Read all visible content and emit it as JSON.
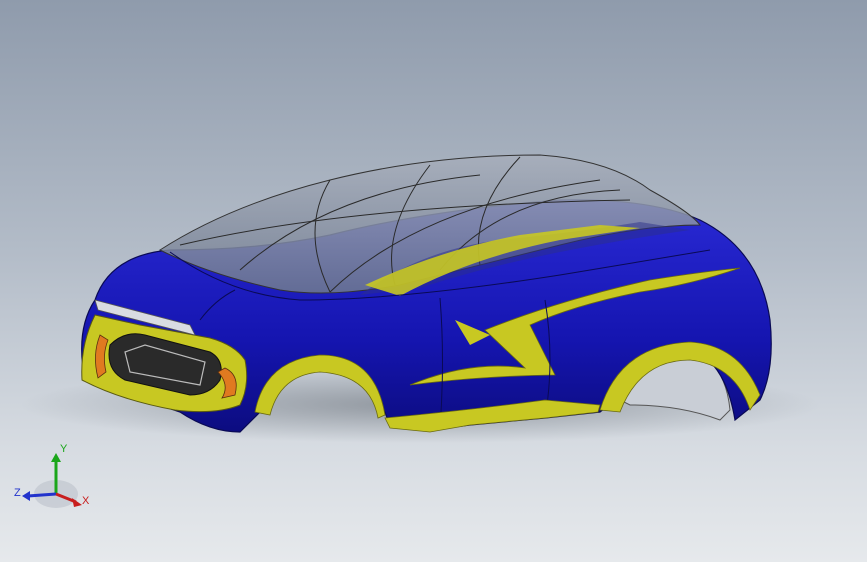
{
  "viewport": {
    "background_top": "#8f9bac",
    "background_bottom": "#e6e9ec"
  },
  "model": {
    "body_color": "#1a1ab8",
    "accent_color": "#c8c822",
    "canopy_color": "#9aa3b2",
    "headlight_color": "#e07a20"
  },
  "triad": {
    "y_label": "Y",
    "x_label": "X",
    "z_label": "Z",
    "y_color": "#1aa61a",
    "x_color": "#c81e1e",
    "z_color": "#2233cc"
  }
}
